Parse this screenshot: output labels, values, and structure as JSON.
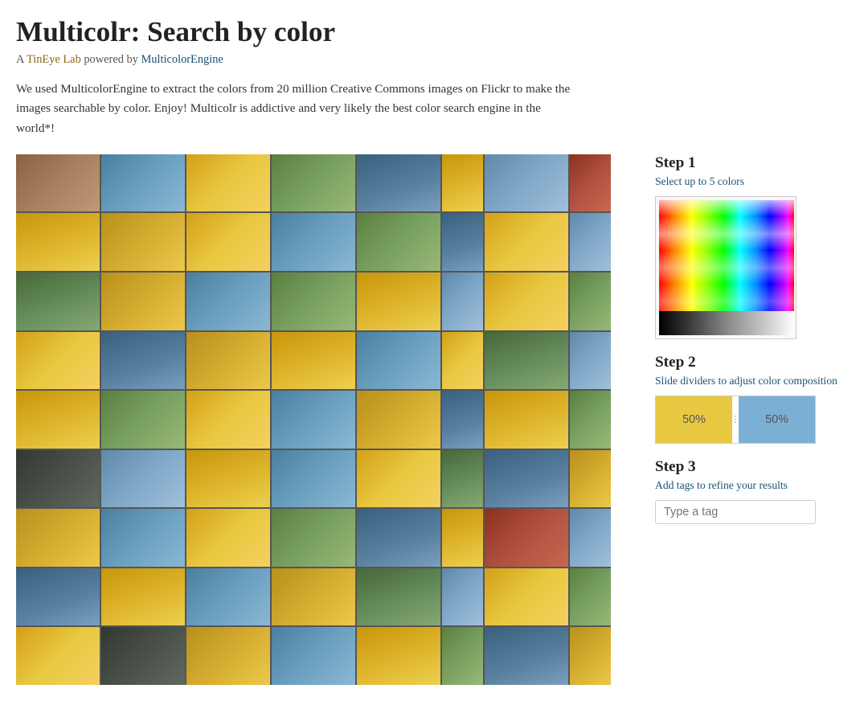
{
  "header": {
    "title": "Multicolr: Search by color",
    "subtitle_prefix": "A ",
    "subtitle_lab": "TinEye Lab",
    "subtitle_middle": " powered by ",
    "subtitle_engine": "MulticolorEngine"
  },
  "description": {
    "text": "We used MulticolorEngine to extract the colors from 20 million Creative Commons images on Flickr to make the images searchable by color. Enjoy! Multicolr is addictive and very likely the best color search engine in the world*!"
  },
  "step1": {
    "heading": "Step 1",
    "sub": "Select up to 5 colors"
  },
  "step2": {
    "heading": "Step 2",
    "sub": "Slide dividers to adjust color composition",
    "segment1_label": "50%",
    "segment2_label": "50%"
  },
  "step3": {
    "heading": "Step 3",
    "sub": "Add tags to refine your results",
    "input_placeholder": "Type a tag"
  }
}
